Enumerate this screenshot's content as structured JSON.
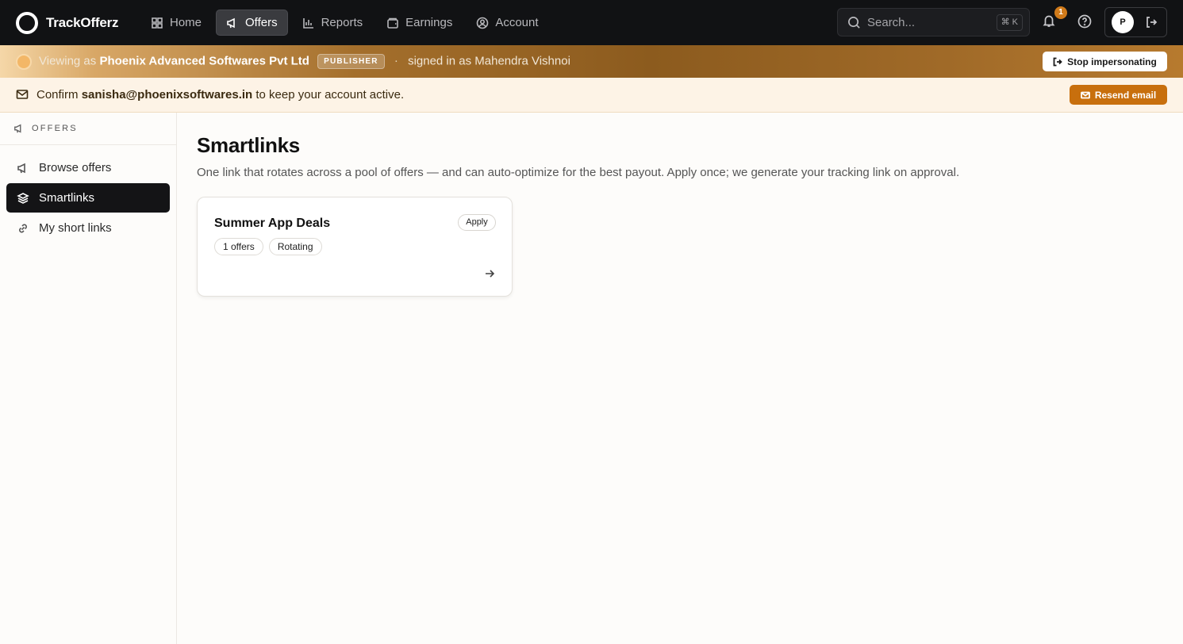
{
  "brand": {
    "name": "TrackOfferz"
  },
  "nav": {
    "items": [
      {
        "label": "Home",
        "icon": "grid-icon"
      },
      {
        "label": "Offers",
        "icon": "megaphone-icon",
        "active": true
      },
      {
        "label": "Reports",
        "icon": "bar-chart-icon"
      },
      {
        "label": "Earnings",
        "icon": "wallet-icon"
      },
      {
        "label": "Account",
        "icon": "user-circle-icon"
      }
    ]
  },
  "search": {
    "placeholder": "Search...",
    "shortcut": "⌘ K"
  },
  "notifications": {
    "count": "1"
  },
  "user": {
    "initial": "P"
  },
  "impersonation": {
    "prefix": "Viewing as",
    "company": "Phoenix Advanced Softwares Pvt Ltd",
    "role_badge": "PUBLISHER",
    "separator": "·",
    "signed_in_text": "signed in as Mahendra Vishnoi",
    "stop_label": "Stop impersonating"
  },
  "confirm_email": {
    "prefix": "Confirm",
    "email": "sanisha@phoenixsoftwares.in",
    "suffix": "to keep your account active.",
    "button_label": "Resend email"
  },
  "sidebar": {
    "section_label": "OFFERS",
    "items": [
      {
        "label": "Browse offers",
        "icon": "megaphone-icon"
      },
      {
        "label": "Smartlinks",
        "icon": "layers-icon",
        "active": true
      },
      {
        "label": "My short links",
        "icon": "link-icon"
      }
    ]
  },
  "main": {
    "title": "Smartlinks",
    "description": "One link that rotates across a pool of offers — and can auto-optimize for the best payout. Apply once; we generate your tracking link on approval.",
    "cards": [
      {
        "title": "Summer App Deals",
        "apply_label": "Apply",
        "chips": [
          "1 offers",
          "Rotating"
        ]
      }
    ]
  },
  "colors": {
    "nav_bg": "#111214",
    "accent_orange": "#c86f0d",
    "active_sidebar_bg": "#141416",
    "page_bg": "#fdfcfa"
  }
}
